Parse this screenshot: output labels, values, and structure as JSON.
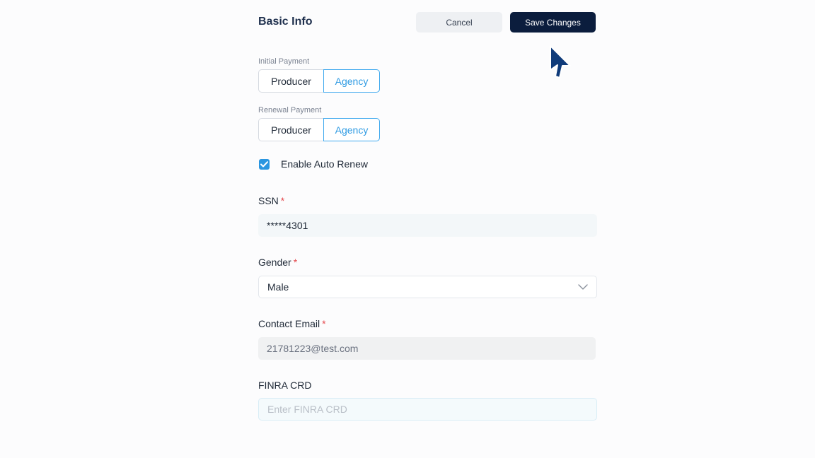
{
  "header": {
    "title": "Basic Info",
    "cancel_label": "Cancel",
    "save_label": "Save Changes"
  },
  "initial_payment": {
    "label": "Initial Payment",
    "options": [
      "Producer",
      "Agency"
    ],
    "selected": "Agency"
  },
  "renewal_payment": {
    "label": "Renewal Payment",
    "options": [
      "Producer",
      "Agency"
    ],
    "selected": "Agency"
  },
  "auto_renew": {
    "label": "Enable Auto Renew",
    "checked": true
  },
  "ssn": {
    "label": "SSN",
    "required_mark": "*",
    "value": "*****4301"
  },
  "gender": {
    "label": "Gender",
    "required_mark": "*",
    "value": "Male"
  },
  "contact_email": {
    "label": "Contact Email",
    "required_mark": "*",
    "value": "21781223@test.com"
  },
  "finra_crd": {
    "label": "FINRA CRD",
    "placeholder": "Enter FINRA CRD"
  },
  "colors": {
    "primary_dark": "#0b1d3d",
    "accent_blue": "#2f9be3",
    "required_red": "#e5484d"
  }
}
